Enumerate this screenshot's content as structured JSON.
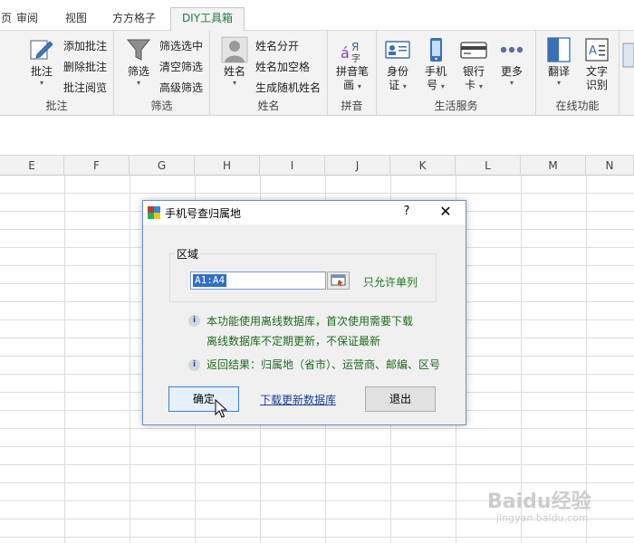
{
  "tabs": {
    "page_partial": "页",
    "review": "审阅",
    "view": "视图",
    "ffgz": "方方格子",
    "diy": "DIY工具箱"
  },
  "ribbon": {
    "comments": {
      "big": "批注",
      "add": "添加批注",
      "delete": "删除批注",
      "browse": "批注阅览",
      "label": "批注"
    },
    "filter": {
      "big": "筛选",
      "select_center": "筛选选中",
      "clear": "清空筛选",
      "advanced": "高级筛选",
      "label": "筛选"
    },
    "name": {
      "big": "姓名",
      "split": "姓名分开",
      "add_space": "姓名加空格",
      "random": "生成随机姓名",
      "label": "姓名"
    },
    "pinyin": {
      "big_line1": "拼音笔",
      "big_line2": "画",
      "label": "拼音"
    },
    "life": {
      "id_line1": "身份",
      "id_line2": "证",
      "phone_line1": "手机",
      "phone_line2": "号",
      "bank_line1": "银行",
      "bank_line2": "卡",
      "more": "更多",
      "label": "生活服务"
    },
    "online": {
      "translate": "翻译",
      "ocr_line1": "文字",
      "ocr_line2": "识别",
      "label": "在线功能"
    }
  },
  "columns": [
    "E",
    "F",
    "G",
    "H",
    "I",
    "J",
    "K",
    "L",
    "M",
    "N"
  ],
  "dialog": {
    "title": "手机号查归属地",
    "help": "?",
    "close": "✕",
    "region_legend": "区域",
    "range_value": "A1:A4",
    "only_single_col": "只允许单列",
    "info1_line1": "本功能使用离线数据库，首次使用需要下载",
    "info1_line2": "离线数据库不定期更新，不保证最新",
    "info2": "返回结果：归属地（省市）、运营商、邮编、区号",
    "ok": "确定",
    "download_link": "下载更新数据库",
    "exit": "退出"
  },
  "watermark": {
    "main": "Baidu经验",
    "sub": "jingyan.baidu.com"
  },
  "colors": {
    "accent_green": "#1d7a3a",
    "info_green": "#1f6a1f",
    "link_blue": "#1b3f9b",
    "selection_blue": "#2f6fc4"
  }
}
